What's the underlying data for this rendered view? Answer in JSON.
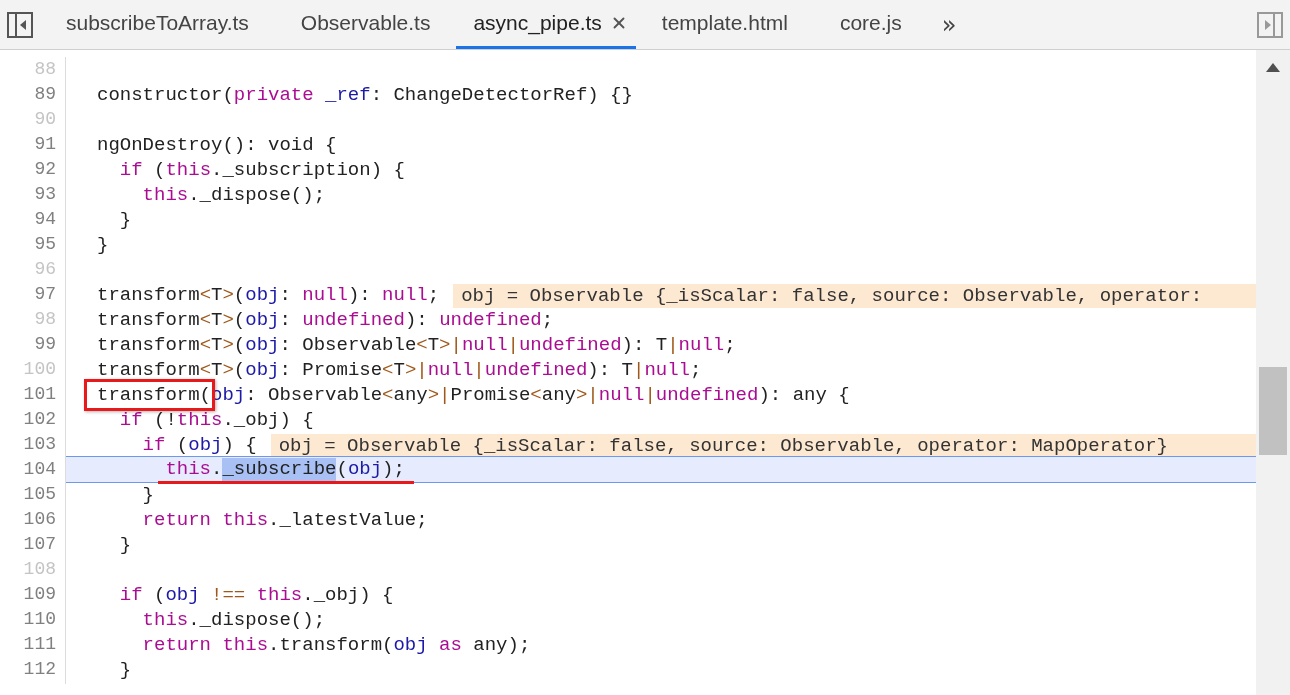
{
  "tabs": [
    {
      "label": "subscribeToArray.ts",
      "selected": false
    },
    {
      "label": "Observable.ts",
      "selected": false
    },
    {
      "label": "async_pipe.ts",
      "selected": true
    },
    {
      "label": "template.html",
      "selected": false
    },
    {
      "label": "core.js",
      "selected": false
    }
  ],
  "tabs_overflow": "»",
  "lines": [
    {
      "number": "88",
      "breakable": false
    },
    {
      "number": "89",
      "breakable": true,
      "tokens": [
        {
          "t": "constructor(",
          "kind": "plain"
        },
        {
          "t": "private ",
          "kind": "keyword"
        },
        {
          "t": "_ref",
          "kind": "variable"
        },
        {
          "t": ": ChangeDetectorRef) {}",
          "kind": "plain"
        }
      ]
    },
    {
      "number": "90",
      "breakable": false
    },
    {
      "number": "91",
      "breakable": true,
      "tokens": [
        {
          "t": "ngOnDestroy(): void {",
          "kind": "plain"
        }
      ]
    },
    {
      "number": "92",
      "breakable": true,
      "tokens": [
        {
          "t": "  if",
          "kind": "keyword"
        },
        {
          "t": " (",
          "kind": "plain"
        },
        {
          "t": "this",
          "kind": "keyword"
        },
        {
          "t": "._subscription) {",
          "kind": "plain"
        }
      ]
    },
    {
      "number": "93",
      "breakable": true,
      "tokens": [
        {
          "t": "    this",
          "kind": "keyword"
        },
        {
          "t": "._dispose();",
          "kind": "plain"
        }
      ]
    },
    {
      "number": "94",
      "breakable": true,
      "tokens": [
        {
          "t": "  }",
          "kind": "plain"
        }
      ]
    },
    {
      "number": "95",
      "breakable": true,
      "tokens": [
        {
          "t": "}",
          "kind": "plain"
        }
      ]
    },
    {
      "number": "96",
      "breakable": false
    },
    {
      "number": "97",
      "breakable": true,
      "tokens": [
        {
          "t": "transform",
          "kind": "plain"
        },
        {
          "t": "<",
          "kind": "operator"
        },
        {
          "t": "T",
          "kind": "plain"
        },
        {
          "t": ">",
          "kind": "operator"
        },
        {
          "t": "(",
          "kind": "plain"
        },
        {
          "t": "obj",
          "kind": "variable"
        },
        {
          "t": ": ",
          "kind": "plain"
        },
        {
          "t": "null",
          "kind": "keyword"
        },
        {
          "t": "): ",
          "kind": "plain"
        },
        {
          "t": "null",
          "kind": "keyword"
        },
        {
          "t": ";",
          "kind": "plain"
        }
      ],
      "inline_value": "obj = Observable {_isScalar: false, source: Observable, operator:"
    },
    {
      "number": "98",
      "breakable": false,
      "tokens": [
        {
          "t": "transform",
          "kind": "plain"
        },
        {
          "t": "<",
          "kind": "operator"
        },
        {
          "t": "T",
          "kind": "plain"
        },
        {
          "t": ">",
          "kind": "operator"
        },
        {
          "t": "(",
          "kind": "plain"
        },
        {
          "t": "obj",
          "kind": "variable"
        },
        {
          "t": ": ",
          "kind": "plain"
        },
        {
          "t": "undefined",
          "kind": "keyword"
        },
        {
          "t": "): ",
          "kind": "plain"
        },
        {
          "t": "undefined",
          "kind": "keyword"
        },
        {
          "t": ";",
          "kind": "plain"
        }
      ]
    },
    {
      "number": "99",
      "breakable": true,
      "tokens": [
        {
          "t": "transform",
          "kind": "plain"
        },
        {
          "t": "<",
          "kind": "operator"
        },
        {
          "t": "T",
          "kind": "plain"
        },
        {
          "t": ">",
          "kind": "operator"
        },
        {
          "t": "(",
          "kind": "plain"
        },
        {
          "t": "obj",
          "kind": "variable"
        },
        {
          "t": ": Observable",
          "kind": "plain"
        },
        {
          "t": "<",
          "kind": "operator"
        },
        {
          "t": "T",
          "kind": "plain"
        },
        {
          "t": ">|",
          "kind": "operator"
        },
        {
          "t": "null",
          "kind": "keyword"
        },
        {
          "t": "|",
          "kind": "operator"
        },
        {
          "t": "undefined",
          "kind": "keyword"
        },
        {
          "t": "): T",
          "kind": "plain"
        },
        {
          "t": "|",
          "kind": "operator"
        },
        {
          "t": "null",
          "kind": "keyword"
        },
        {
          "t": ";",
          "kind": "plain"
        }
      ]
    },
    {
      "number": "100",
      "breakable": false,
      "tokens": [
        {
          "t": "transform",
          "kind": "plain"
        },
        {
          "t": "<",
          "kind": "operator"
        },
        {
          "t": "T",
          "kind": "plain"
        },
        {
          "t": ">",
          "kind": "operator"
        },
        {
          "t": "(",
          "kind": "plain"
        },
        {
          "t": "obj",
          "kind": "variable"
        },
        {
          "t": ": Promise",
          "kind": "plain"
        },
        {
          "t": "<",
          "kind": "operator"
        },
        {
          "t": "T",
          "kind": "plain"
        },
        {
          "t": ">|",
          "kind": "operator"
        },
        {
          "t": "null",
          "kind": "keyword"
        },
        {
          "t": "|",
          "kind": "operator"
        },
        {
          "t": "undefined",
          "kind": "keyword"
        },
        {
          "t": "): T",
          "kind": "plain"
        },
        {
          "t": "|",
          "kind": "operator"
        },
        {
          "t": "null",
          "kind": "keyword"
        },
        {
          "t": ";",
          "kind": "plain"
        }
      ]
    },
    {
      "number": "101",
      "breakable": true,
      "tokens": [
        {
          "t": "transform(",
          "kind": "plain",
          "boxed": true
        },
        {
          "t": "obj",
          "kind": "variable"
        },
        {
          "t": ": Observable",
          "kind": "plain"
        },
        {
          "t": "<",
          "kind": "operator"
        },
        {
          "t": "any",
          "kind": "plain"
        },
        {
          "t": ">|",
          "kind": "operator"
        },
        {
          "t": "Promise",
          "kind": "plain"
        },
        {
          "t": "<",
          "kind": "operator"
        },
        {
          "t": "any",
          "kind": "plain"
        },
        {
          "t": ">|",
          "kind": "operator"
        },
        {
          "t": "null",
          "kind": "keyword"
        },
        {
          "t": "|",
          "kind": "operator"
        },
        {
          "t": "undefined",
          "kind": "keyword"
        },
        {
          "t": "): any {",
          "kind": "plain"
        }
      ]
    },
    {
      "number": "102",
      "breakable": true,
      "tokens": [
        {
          "t": "  if",
          "kind": "keyword"
        },
        {
          "t": " (!",
          "kind": "plain"
        },
        {
          "t": "this",
          "kind": "keyword"
        },
        {
          "t": "._obj) {",
          "kind": "plain"
        }
      ]
    },
    {
      "number": "103",
      "breakable": true,
      "tokens": [
        {
          "t": "    if",
          "kind": "keyword"
        },
        {
          "t": " (",
          "kind": "plain"
        },
        {
          "t": "obj",
          "kind": "variable"
        },
        {
          "t": ") {",
          "kind": "plain"
        }
      ],
      "inline_value": "obj = Observable {_isScalar: false, source: Observable, operator: MapOperator}"
    },
    {
      "number": "104",
      "breakable": true,
      "paused": true,
      "underlined": true,
      "tokens": [
        {
          "t": "      this",
          "kind": "keyword"
        },
        {
          "t": ".",
          "kind": "plain"
        },
        {
          "t": "_subscribe",
          "kind": "plain",
          "selected": true
        },
        {
          "t": "(",
          "kind": "plain"
        },
        {
          "t": "obj",
          "kind": "variable"
        },
        {
          "t": ");",
          "kind": "plain"
        }
      ]
    },
    {
      "number": "105",
      "breakable": true,
      "tokens": [
        {
          "t": "    }",
          "kind": "plain"
        }
      ]
    },
    {
      "number": "106",
      "breakable": true,
      "tokens": [
        {
          "t": "    return this",
          "kind": "keyword"
        },
        {
          "t": "._latestValue;",
          "kind": "plain"
        }
      ]
    },
    {
      "number": "107",
      "breakable": true,
      "tokens": [
        {
          "t": "  }",
          "kind": "plain"
        }
      ]
    },
    {
      "number": "108",
      "breakable": false
    },
    {
      "number": "109",
      "breakable": true,
      "tokens": [
        {
          "t": "  if",
          "kind": "keyword"
        },
        {
          "t": " (",
          "kind": "plain"
        },
        {
          "t": "obj",
          "kind": "variable"
        },
        {
          "t": " !==",
          "kind": "operator"
        },
        {
          "t": " this",
          "kind": "keyword"
        },
        {
          "t": "._obj) {",
          "kind": "plain"
        }
      ]
    },
    {
      "number": "110",
      "breakable": true,
      "tokens": [
        {
          "t": "    this",
          "kind": "keyword"
        },
        {
          "t": "._dispose();",
          "kind": "plain"
        }
      ]
    },
    {
      "number": "111",
      "breakable": true,
      "tokens": [
        {
          "t": "    return this",
          "kind": "keyword"
        },
        {
          "t": ".transform(",
          "kind": "plain"
        },
        {
          "t": "obj",
          "kind": "variable"
        },
        {
          "t": " as",
          "kind": "keyword"
        },
        {
          "t": " any);",
          "kind": "plain"
        }
      ]
    },
    {
      "number": "112",
      "breakable": true,
      "tokens": [
        {
          "t": "  }",
          "kind": "plain"
        }
      ]
    }
  ]
}
